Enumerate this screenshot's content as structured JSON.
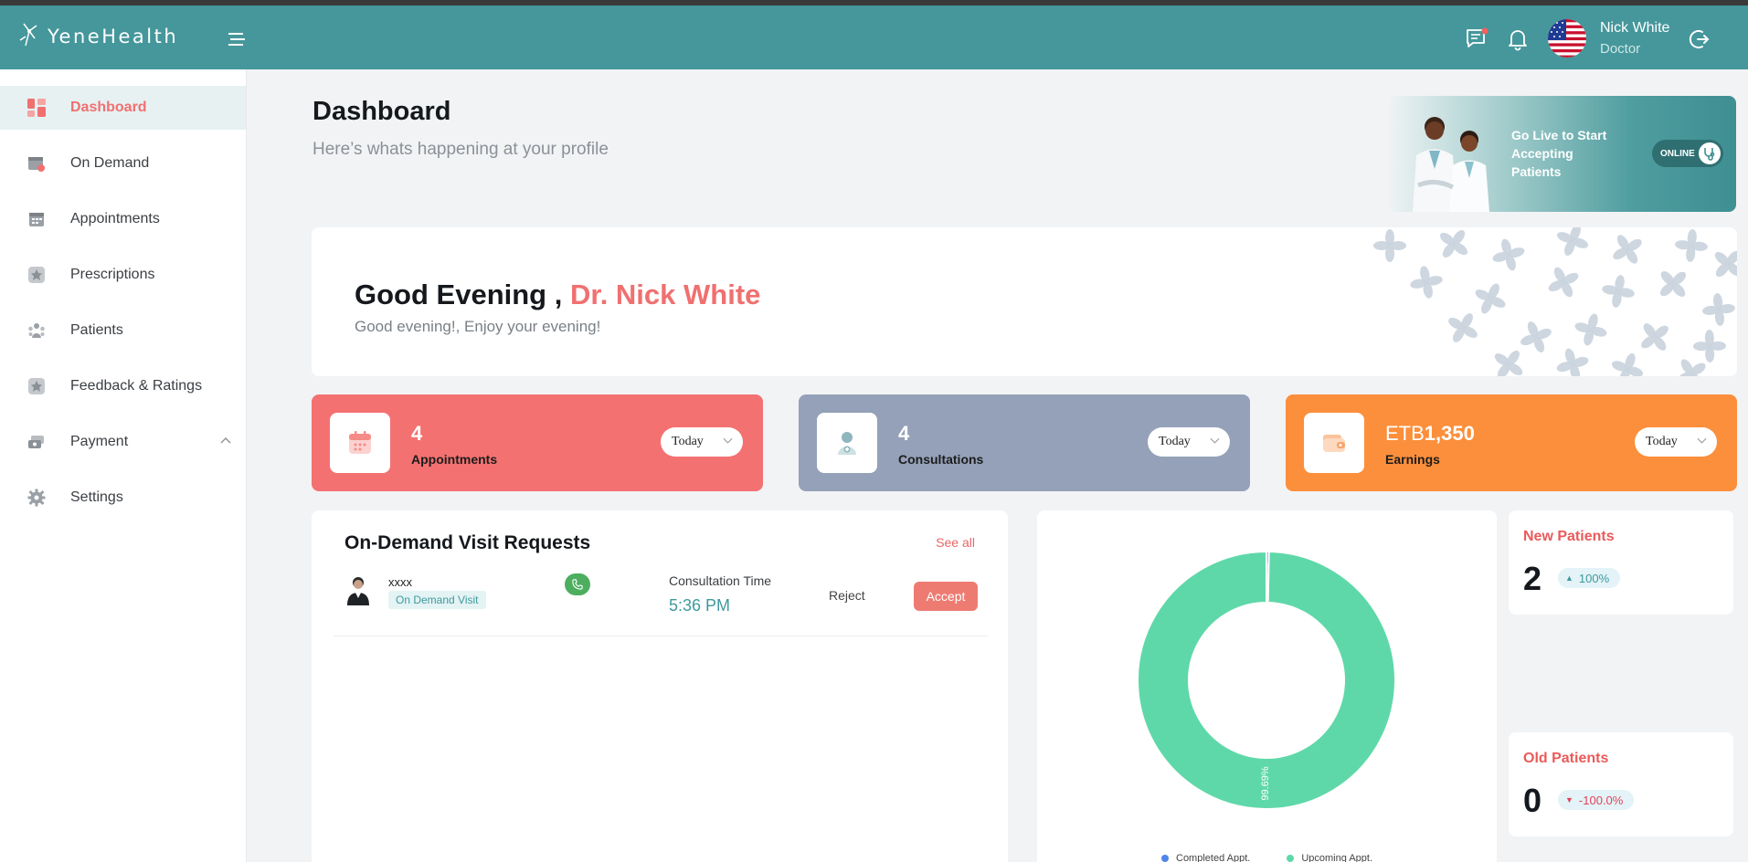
{
  "header": {
    "logo_text": "YeneHealth",
    "user_name": "Nick White",
    "user_role": "Doctor"
  },
  "sidebar": {
    "items": [
      {
        "label": "Dashboard",
        "icon": "dashboard-icon",
        "active": true
      },
      {
        "label": "On Demand",
        "icon": "calendar-clock-icon"
      },
      {
        "label": "Appointments",
        "icon": "calendar-icon"
      },
      {
        "label": "Prescriptions",
        "icon": "prescription-icon"
      },
      {
        "label": "Patients",
        "icon": "patients-icon"
      },
      {
        "label": "Feedback & Ratings",
        "icon": "star-badge-icon"
      },
      {
        "label": "Payment",
        "icon": "payment-icon"
      },
      {
        "label": "Settings",
        "icon": "gear-icon"
      }
    ]
  },
  "page": {
    "title": "Dashboard",
    "subtitle": "Here’s whats happening at your profile"
  },
  "live": {
    "text": "Go Live to Start Accepting Patients",
    "status": "ONLINE"
  },
  "greeting": {
    "prefix": "Good Evening , ",
    "name": "Dr. Nick White",
    "message": "Good evening!, Enjoy your evening!"
  },
  "stats": [
    {
      "value": "4",
      "label": "Appointments",
      "period": "Today",
      "color": "#f47171"
    },
    {
      "value": "4",
      "label": "Consultations",
      "period": "Today",
      "color": "#94a1b8"
    },
    {
      "currency": "ETB",
      "value": "1,350",
      "label": "Earnings",
      "period": "Today",
      "color": "#fc8f3b"
    }
  ],
  "requests": {
    "title": "On-Demand Visit Requests",
    "see_all": "See all",
    "items": [
      {
        "name": "xxxx",
        "badge": "On Demand Visit",
        "time_label": "Consultation Time",
        "time": "5:36 PM",
        "reject": "Reject",
        "accept": "Accept"
      }
    ]
  },
  "chart_data": {
    "type": "pie",
    "donut": true,
    "categories": [
      "Completed Appt.",
      "Upcoming Appt."
    ],
    "values": [
      0.31,
      99.69
    ],
    "slice_labels": [
      "0.31%",
      "99.69%"
    ],
    "colors": [
      "#4f86e8",
      "#5fd8a9"
    ],
    "legend": "bottom"
  },
  "patients": {
    "new": {
      "title": "New Patients",
      "value": "2",
      "change": "100%",
      "trend": "up",
      "color": "#3e9a9d"
    },
    "old": {
      "title": "Old Patients",
      "value": "0",
      "change": "-100.0%",
      "trend": "down",
      "color": "#e3435a"
    }
  }
}
